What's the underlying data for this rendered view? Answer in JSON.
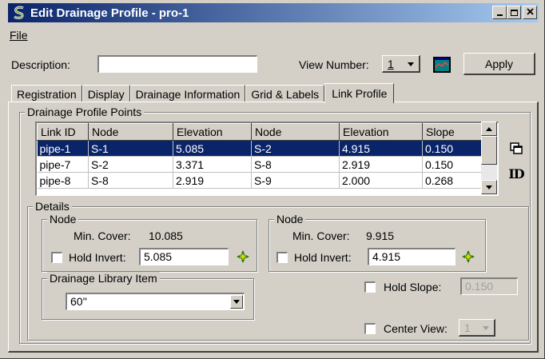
{
  "window": {
    "title": "Edit Drainage Profile - pro-1",
    "icon": "drainage-s-icon",
    "buttons": {
      "minimize": "_",
      "maximize": "□",
      "close": "×"
    }
  },
  "menu": {
    "file": "File"
  },
  "toolbar": {
    "description_label": "Description:",
    "description_value": "",
    "view_number_label": "View Number:",
    "view_number_value": "1",
    "view_icon": "view-window-icon",
    "apply_label": "Apply"
  },
  "tabs": [
    {
      "label": "Registration",
      "active": false
    },
    {
      "label": "Display",
      "active": false
    },
    {
      "label": "Drainage Information",
      "active": false
    },
    {
      "label": "Grid & Labels",
      "active": false
    },
    {
      "label": "Link Profile",
      "active": true
    }
  ],
  "points": {
    "group_title": "Drainage Profile Points",
    "columns": [
      "Link ID",
      "Node",
      "Elevation",
      "Node",
      "Elevation",
      "Slope"
    ],
    "rows": [
      [
        "pipe-1",
        "S-1",
        "5.085",
        "S-2",
        "4.915",
        "0.150"
      ],
      [
        "pipe-7",
        "S-2",
        "3.371",
        "S-8",
        "2.919",
        "0.150"
      ],
      [
        "pipe-8",
        "S-8",
        "2.919",
        "S-9",
        "2.000",
        "0.268"
      ]
    ],
    "selected_row": 0,
    "side_icons": [
      "copy-icon",
      "id-icon"
    ],
    "id_icon_text": "ID"
  },
  "details": {
    "group_title": "Details",
    "node_left": {
      "title": "Node",
      "min_cover_label": "Min. Cover:",
      "min_cover_value": "10.085",
      "hold_invert_label": "Hold Invert:",
      "hold_invert_value": "5.085"
    },
    "node_right": {
      "title": "Node",
      "min_cover_label": "Min. Cover:",
      "min_cover_value": "9.915",
      "hold_invert_label": "Hold Invert:",
      "hold_invert_value": "4.915"
    },
    "library": {
      "title": "Drainage Library Item",
      "value": "60''"
    },
    "hold_slope_label": "Hold Slope:",
    "hold_slope_value": "0.150",
    "center_view_label": "Center View:",
    "center_view_value": "1"
  }
}
